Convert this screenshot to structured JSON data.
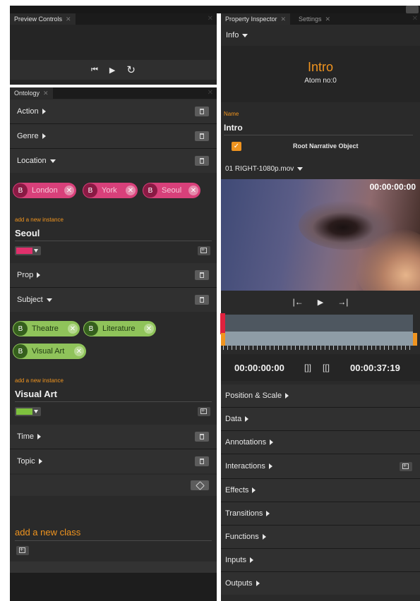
{
  "colors": {
    "accent": "#f0941f",
    "pink": "#d8407a",
    "green": "#8fc35a"
  },
  "preview_panel": {
    "tab_label": "Preview Controls",
    "controls": {
      "first": "⏮",
      "play": "▶",
      "replay": "↻"
    }
  },
  "ontology_panel": {
    "tab_label": "Ontology",
    "classes": [
      {
        "label": "Action",
        "expanded": false
      },
      {
        "label": "Genre",
        "expanded": false
      },
      {
        "label": "Location",
        "expanded": true
      },
      {
        "label": "Prop",
        "expanded": false
      },
      {
        "label": "Subject",
        "expanded": true
      },
      {
        "label": "Time",
        "expanded": false
      },
      {
        "label": "Topic",
        "expanded": false
      }
    ],
    "location": {
      "chips": [
        {
          "badge": "B",
          "label": "London"
        },
        {
          "badge": "B",
          "label": "York"
        },
        {
          "badge": "B",
          "label": "Seoul"
        }
      ],
      "add_instance_label": "add a new instance",
      "instance_value": "Seoul",
      "color": "#e0306c"
    },
    "subject": {
      "chips": [
        {
          "badge": "B",
          "label": "Theatre"
        },
        {
          "badge": "B",
          "label": "Literature"
        },
        {
          "badge": "B",
          "label": "Visual Art"
        }
      ],
      "add_instance_label": "add a new instance",
      "instance_value": "Visual Art",
      "color": "#7ec13e"
    },
    "add_class_label": "add a new class"
  },
  "inspector_panel": {
    "tabs": [
      {
        "label": "Property Inspector"
      },
      {
        "label": "Settings"
      }
    ],
    "info_label": "Info",
    "object_title": "Intro",
    "atom_label": "Atom no:0",
    "name_label": "Name",
    "name_value": "Intro",
    "root_checkbox_label": "Root Narrative Object",
    "root_checked": true,
    "media_file": "01 RIGHT-1080p.mov",
    "video_timecode": "00:00:00:00",
    "transport": {
      "first": "|←",
      "play": "▶",
      "last": "→|"
    },
    "timeline": {
      "start": "00:00:00:00",
      "end": "00:00:37:19",
      "in_icon": "[]]",
      "out_icon": "[[]"
    },
    "sections": [
      {
        "label": "Position & Scale"
      },
      {
        "label": "Data"
      },
      {
        "label": "Annotations"
      },
      {
        "label": "Interactions"
      },
      {
        "label": "Effects"
      },
      {
        "label": "Transitions"
      },
      {
        "label": "Functions"
      },
      {
        "label": "Inputs"
      },
      {
        "label": "Outputs"
      }
    ]
  }
}
